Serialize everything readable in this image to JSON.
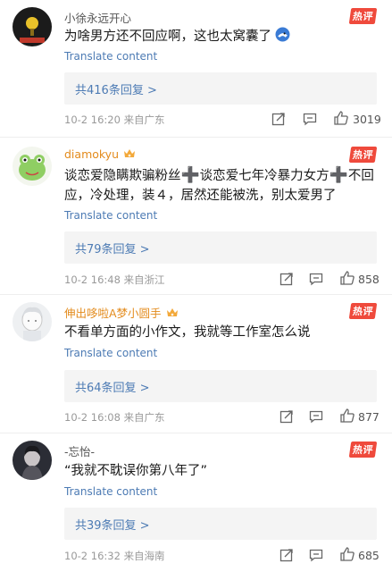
{
  "comments": [
    {
      "username": "小徐永远开心",
      "hot_label": "热评",
      "text": "为啥男方还不回应啊，这也太窝囊了",
      "translate": "Translate content",
      "replies": "共416条回复 >",
      "date": "10-2 16:20",
      "location": "来自广东",
      "likes": "3019"
    },
    {
      "username": "diamokyu",
      "hot_label": "热评",
      "text_parts": [
        "谈恋爱隐瞒欺骗粉丝",
        "➕",
        "谈恋爱七年冷暴力女方",
        "➕",
        "不回应，冷处理，装４，居然还能被洗，别太爱男了"
      ],
      "translate": "Translate content",
      "replies": "共79条回复 >",
      "date": "10-2 16:48",
      "location": "来自浙江",
      "likes": "858"
    },
    {
      "username": "伸出哆啦A梦小圆手",
      "hot_label": "热评",
      "text": "不看单方面的小作文，我就等工作室怎么说",
      "translate": "Translate content",
      "replies": "共64条回复 >",
      "date": "10-2 16:08",
      "location": "来自广东",
      "likes": "877"
    },
    {
      "username": "-忘怡-",
      "hot_label": "热评",
      "text": "“我就不耽误你第八年了”",
      "translate": "Translate content",
      "replies": "共39条回复 >",
      "date": "10-2 16:32",
      "location": "来自海南",
      "likes": "685"
    }
  ]
}
